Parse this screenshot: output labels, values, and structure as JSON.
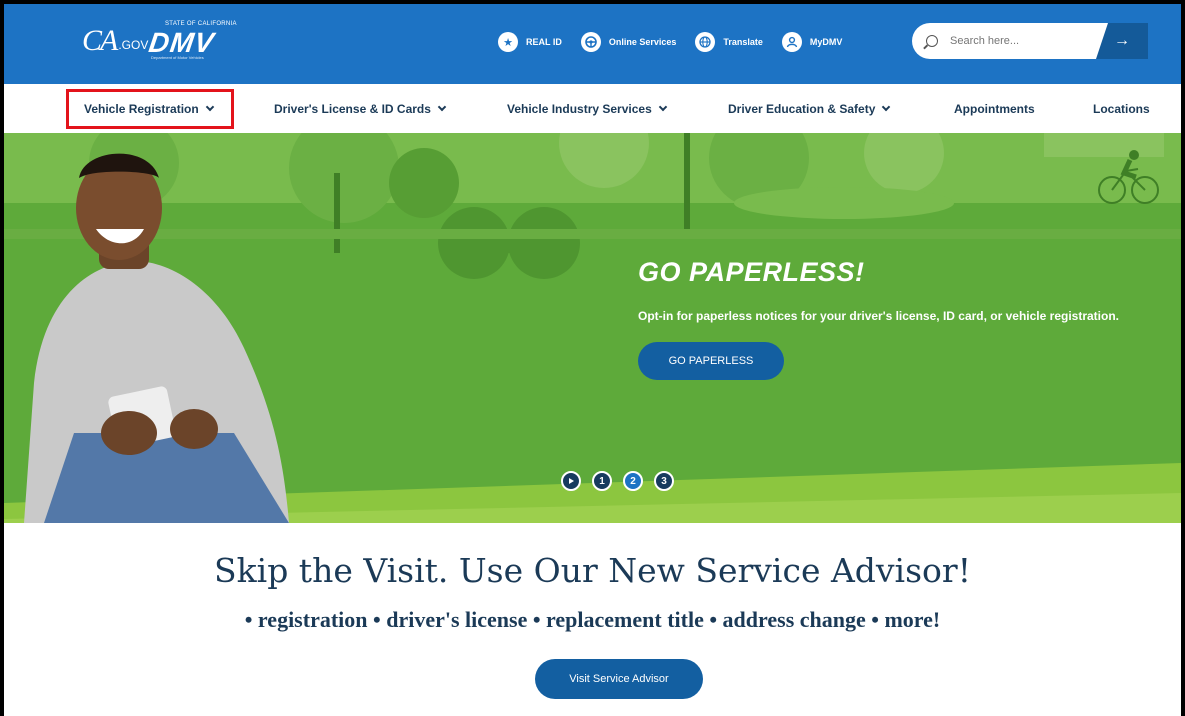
{
  "header": {
    "ca_logo": "CA",
    "ca_logo_suffix": ".GOV",
    "dmv_logo": "DMV",
    "dmv_state": "STATE OF CALIFORNIA",
    "dmv_dept": "Department of Motor Vehicles",
    "links": [
      {
        "label": "REAL ID",
        "icon": "star-icon"
      },
      {
        "label": "Online Services",
        "icon": "steering-wheel-icon"
      },
      {
        "label": "Translate",
        "icon": "globe-icon"
      },
      {
        "label": "MyDMV",
        "icon": "user-icon"
      }
    ],
    "search_placeholder": "Search here...",
    "search_button_icon": "arrow-right-icon"
  },
  "nav": {
    "items": [
      {
        "label": "Vehicle Registration",
        "has_dropdown": true
      },
      {
        "label": "Driver's License & ID Cards",
        "has_dropdown": true
      },
      {
        "label": "Vehicle Industry Services",
        "has_dropdown": true
      },
      {
        "label": "Driver Education & Safety",
        "has_dropdown": true
      },
      {
        "label": "Appointments",
        "has_dropdown": false
      },
      {
        "label": "Locations",
        "has_dropdown": false
      }
    ]
  },
  "hero": {
    "title": "GO PAPERLESS!",
    "subtitle": "Opt-in for paperless notices for your driver's license, ID card, or vehicle registration.",
    "button": "GO PAPERLESS",
    "slides": [
      "1",
      "2",
      "3"
    ],
    "active_slide": "2"
  },
  "advisor": {
    "title": "Skip the Visit. Use Our New Service Advisor!",
    "subtitle": "• registration • driver's license • replacement title • address change • more!",
    "button": "Visit Service Advisor"
  },
  "colors": {
    "header_blue": "#1d73c4",
    "hero_green": "#5eaa3a",
    "button_blue": "#135fa1",
    "nav_text": "#1b3a57",
    "highlight_red": "#e3131b"
  }
}
